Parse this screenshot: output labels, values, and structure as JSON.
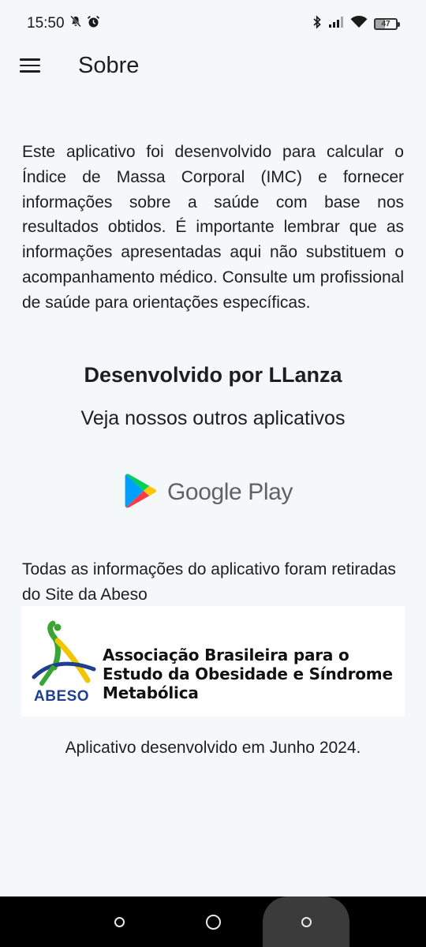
{
  "status_bar": {
    "time": "15:50",
    "battery_level": "47",
    "icons": [
      "mute-icon",
      "alarm-icon",
      "bluetooth-icon",
      "signal-icon",
      "wifi-icon",
      "battery-icon"
    ]
  },
  "app_bar": {
    "menu_icon": "menu-icon",
    "title": "Sobre"
  },
  "content": {
    "about_text": "Este aplicativo foi desenvolvido para calcular o Índice de Massa Corporal (IMC) e fornecer informações sobre a saúde com base nos resultados obtidos. É importante lembrar que as informações apresentadas aqui não substituem o acompanhamento médico. Consulte um profissional de saúde para orientações específicas.",
    "developed_by": "Desenvolvido por LLanza",
    "other_apps": "Veja nossos outros aplicativos",
    "google_play_label": "Google Play",
    "source_text": "Todas as informações do aplicativo foram retiradas do Site da Abeso",
    "abeso": {
      "name": "Associação Brasileira para o Estudo da Obesidade e Síndrome Metabólica",
      "wordmark": "ABESO"
    },
    "dev_date": "Aplicativo desenvolvido em Junho 2024."
  },
  "nav_bar": {
    "buttons": [
      "recent-apps",
      "home",
      "back"
    ]
  },
  "colors": {
    "background": "#f4f8f8",
    "text": "#1c1e1f",
    "abeso_blue": "#1f3f8f",
    "abeso_green": "#3aa535",
    "abeso_yellow": "#f2c500"
  }
}
